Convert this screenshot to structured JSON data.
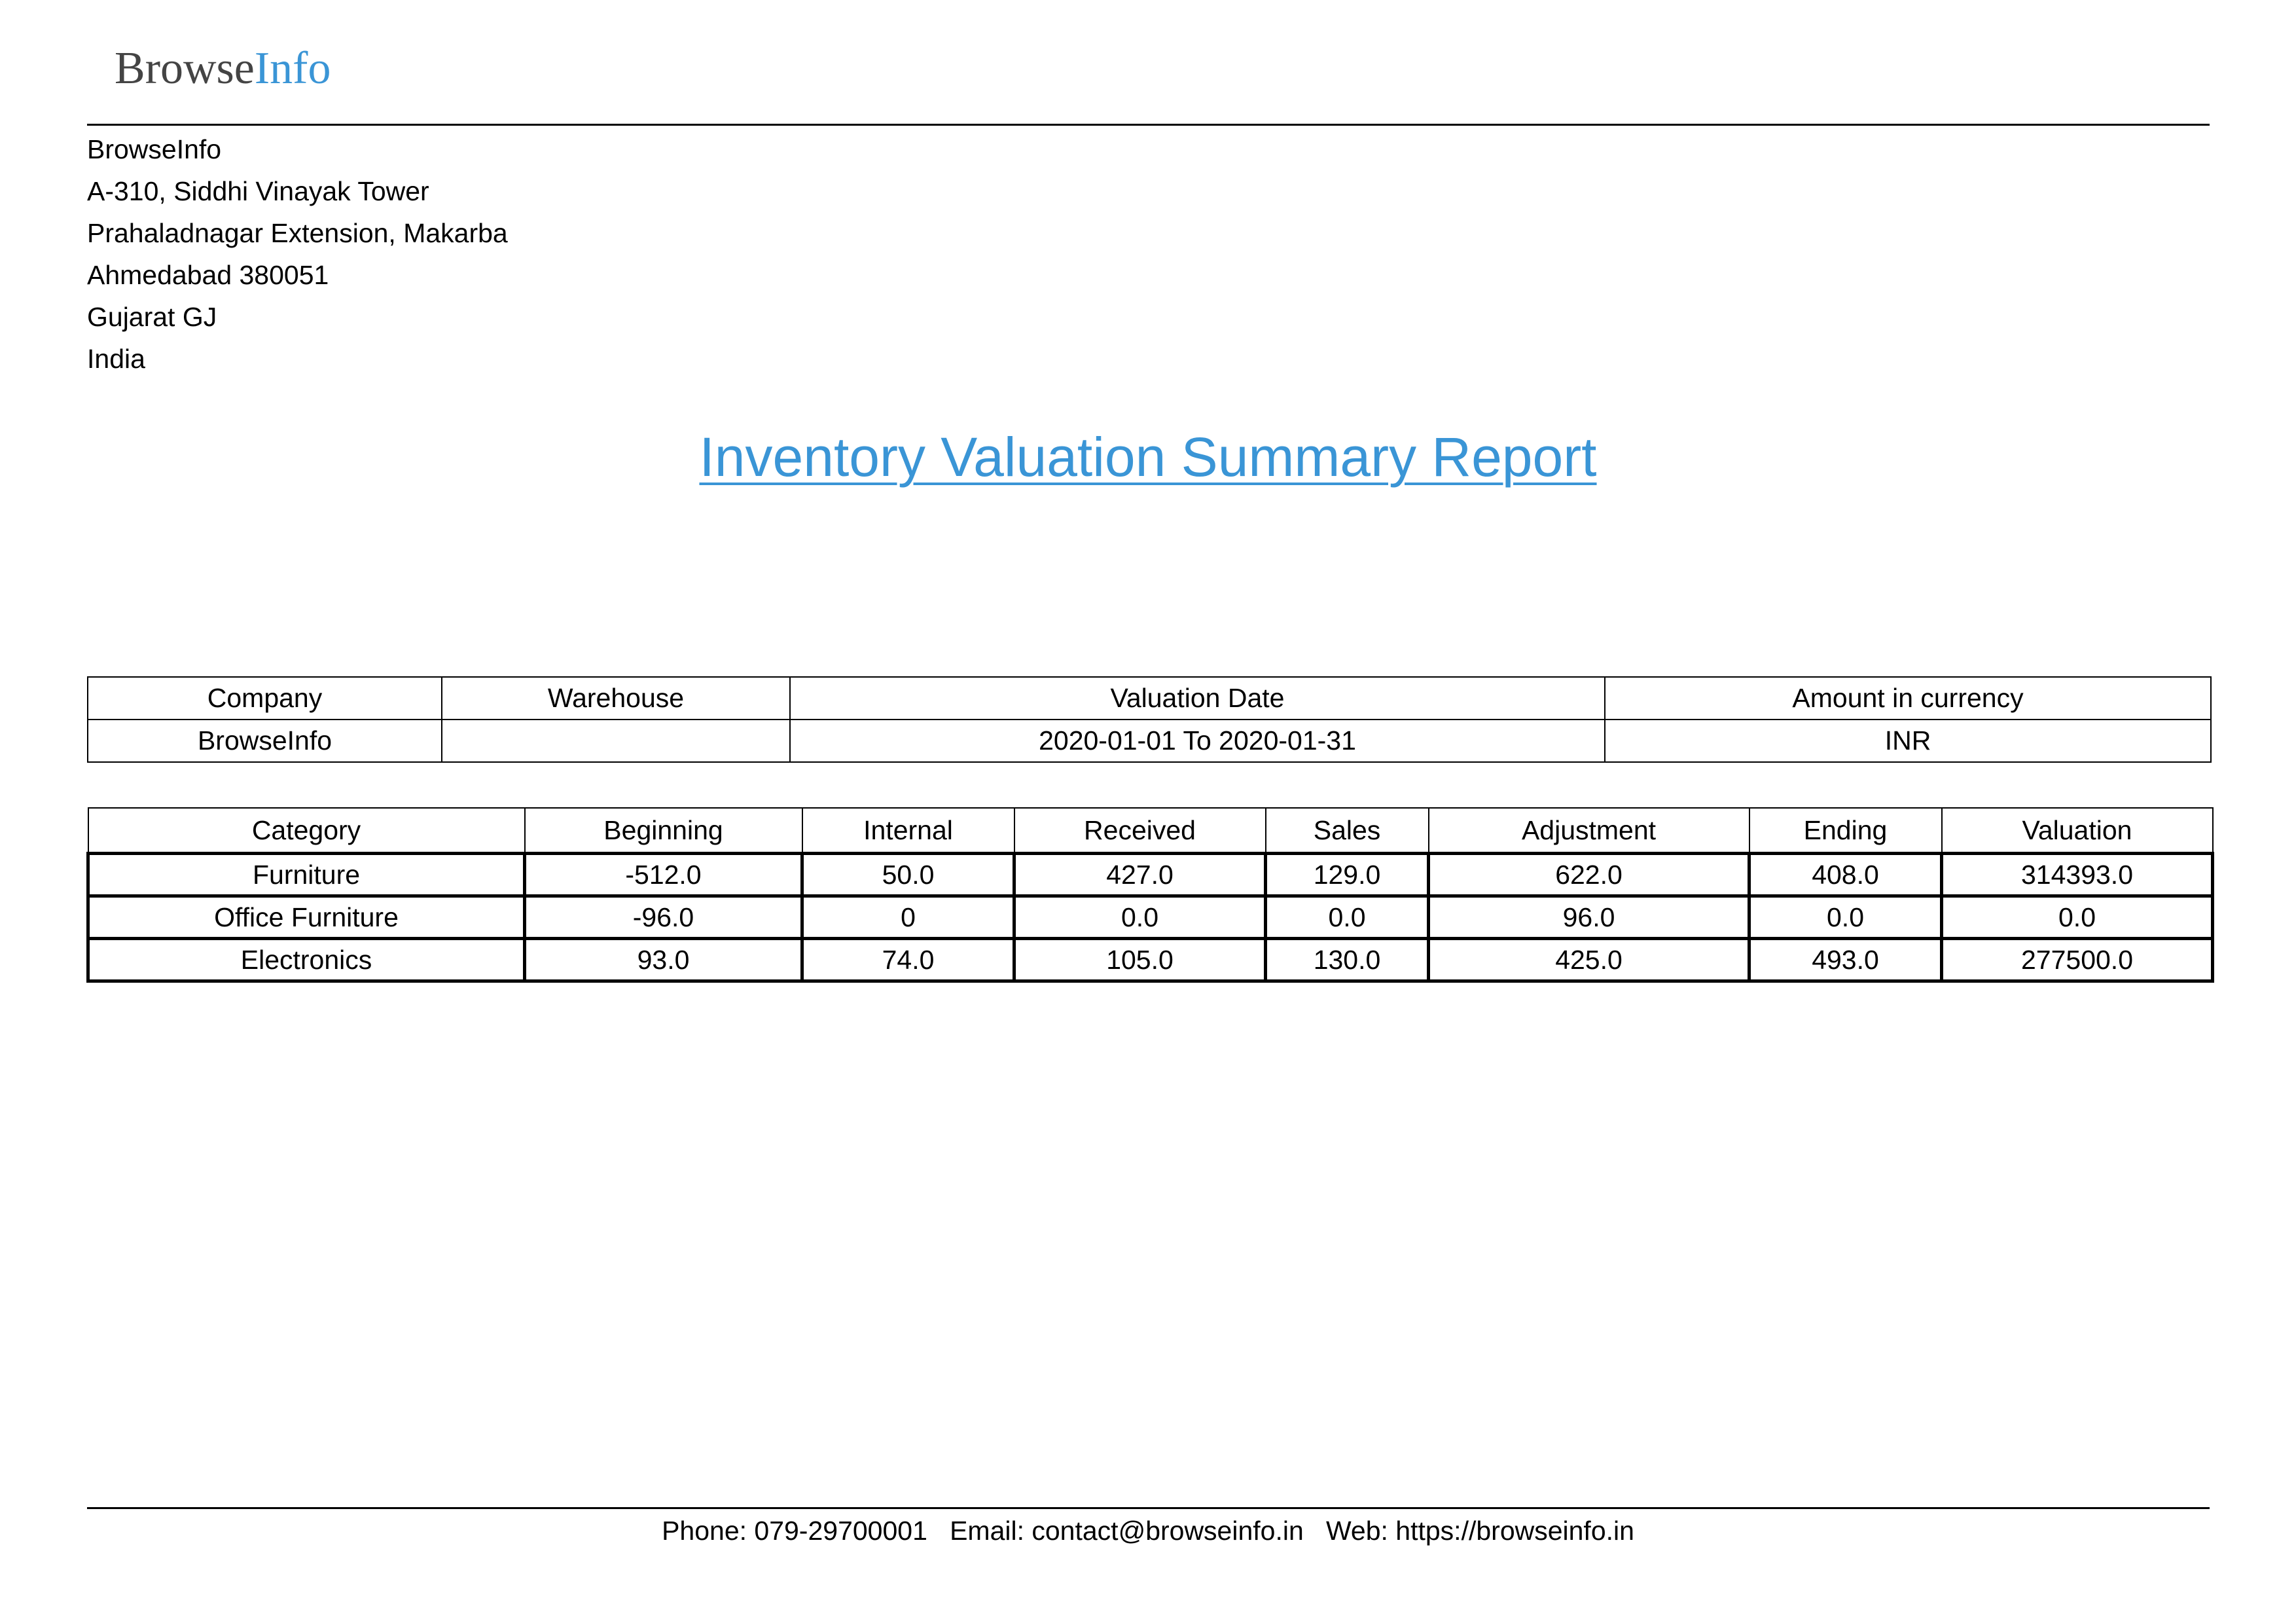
{
  "header": {
    "logo_part1": "Browse",
    "logo_part2": "Info",
    "logo_colors": {
      "browse": "#444444",
      "info": "#3a95d6"
    }
  },
  "address": [
    "BrowseInfo",
    "A-310, Siddhi Vinayak Tower",
    "Prahaladnagar Extension, Makarba",
    "Ahmedabad 380051",
    "Gujarat GJ",
    "India"
  ],
  "title": "Inventory Valuation Summary Report",
  "title_color": "#3a95d6",
  "info_table": {
    "headers": [
      "Company",
      "Warehouse",
      "Valuation Date",
      "Amount in currency"
    ],
    "row": [
      "BrowseInfo",
      "",
      "2020-01-01 To 2020-01-31",
      "INR"
    ]
  },
  "valuation_table": {
    "headers": [
      "Category",
      "Beginning",
      "Internal",
      "Received",
      "Sales",
      "Adjustment",
      "Ending",
      "Valuation"
    ],
    "rows": [
      [
        "Furniture",
        "-512.0",
        "50.0",
        "427.0",
        "129.0",
        "622.0",
        "408.0",
        "314393.0"
      ],
      [
        "Office Furniture",
        "-96.0",
        "0",
        "0.0",
        "0.0",
        "96.0",
        "0.0",
        "0.0"
      ],
      [
        "Electronics",
        "93.0",
        "74.0",
        "105.0",
        "130.0",
        "425.0",
        "493.0",
        "277500.0"
      ]
    ]
  },
  "footer": {
    "phone": "Phone: 079-29700001",
    "email": "Email: contact@browseinfo.in",
    "web": "Web: https://browseinfo.in"
  }
}
